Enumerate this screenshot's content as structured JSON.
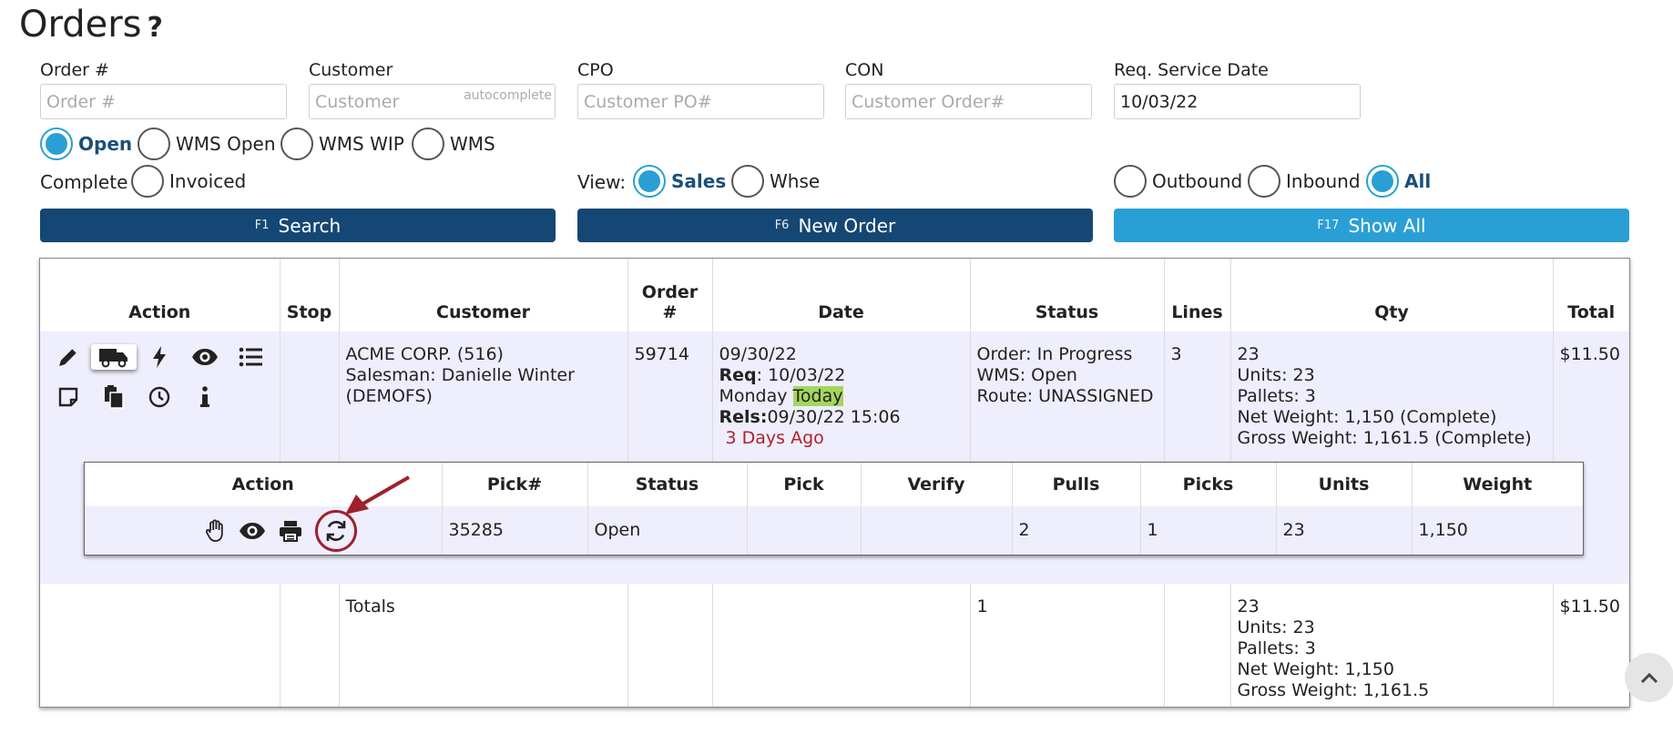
{
  "page": {
    "title": "Orders",
    "help_glyph": "?"
  },
  "filters": {
    "order": {
      "label": "Order #",
      "placeholder": "Order #",
      "value": ""
    },
    "customer": {
      "label": "Customer",
      "placeholder": "Customer",
      "value": "",
      "hint": "autocomplete"
    },
    "cpo": {
      "label": "CPO",
      "placeholder": "Customer PO#",
      "value": ""
    },
    "con": {
      "label": "CON",
      "placeholder": "Customer Order#",
      "value": ""
    },
    "req_date": {
      "label": "Req. Service Date",
      "placeholder": "",
      "value": "10/03/22"
    }
  },
  "status_radios": {
    "open": "Open",
    "wms_open": "WMS Open",
    "wms_wip": "WMS WIP",
    "wms": "WMS",
    "complete": "Complete",
    "invoiced": "Invoiced",
    "selected": "Open"
  },
  "view": {
    "label": "View:",
    "sales": "Sales",
    "whse": "Whse",
    "selected": "Sales"
  },
  "direction": {
    "outbound": "Outbound",
    "inbound": "Inbound",
    "all": "All",
    "selected": "All"
  },
  "buttons": {
    "search": {
      "key": "F1",
      "label": "Search"
    },
    "new_order": {
      "key": "F6",
      "label": "New Order"
    },
    "show_all": {
      "key": "F17",
      "label": "Show All"
    }
  },
  "colors": {
    "primary": "#154774",
    "accent": "#2a9fd6",
    "highlight": "#a4d65e",
    "row_bg": "#eeeefc",
    "alert_red": "#b0222a"
  },
  "orders_table": {
    "headers": {
      "action": "Action",
      "stop": "Stop",
      "customer": "Customer",
      "order_line1": "Order",
      "order_line2": "#",
      "date": "Date",
      "status": "Status",
      "lines": "Lines",
      "qty": "Qty",
      "total": "Total"
    },
    "action_icons": [
      "pencil-icon",
      "truck-icon",
      "bolt-icon",
      "eye-icon",
      "list-icon",
      "note-icon",
      "copy-icon",
      "clock-icon",
      "info-icon"
    ],
    "row": {
      "customer_name": "ACME CORP. (516)",
      "salesman": "Salesman: Danielle Winter (DEMOFS)",
      "order_no": "59714",
      "date": "09/30/22",
      "req_label": "Req",
      "req_value": ": 10/03/22",
      "day": "Monday ",
      "today": "Today",
      "rels_label": "Rels:",
      "rels_value": "09/30/22 15:06",
      "ago": "3 Days Ago",
      "status_order": "Order: In Progress",
      "status_wms": "WMS: Open",
      "status_route": "Route: UNASSIGNED",
      "lines": "3",
      "qty": "23",
      "units": "Units: 23",
      "pallets": "Pallets: 3",
      "net_weight": "Net Weight: 1,150 (Complete)",
      "gross_weight": "Gross Weight: 1,161.5 (Complete)",
      "total": "$11.50"
    },
    "totals": {
      "label": "Totals",
      "status_count": "1",
      "qty": "23",
      "units": "Units: 23",
      "pallets": "Pallets: 3",
      "net_weight": "Net Weight: 1,150",
      "gross_weight": "Gross Weight: 1,161.5",
      "total": "$11.50"
    }
  },
  "picks_table": {
    "headers": {
      "action": "Action",
      "pick_no": "Pick#",
      "status": "Status",
      "pick": "Pick",
      "verify": "Verify",
      "pulls": "Pulls",
      "picks": "Picks",
      "units": "Units",
      "weight": "Weight"
    },
    "action_icons": [
      "hand-icon",
      "eye-icon",
      "print-icon",
      "refresh-icon"
    ],
    "row": {
      "pick_no": "35285",
      "status": "Open",
      "pick": "",
      "verify": "",
      "pulls": "2",
      "picks": "1",
      "units": "23",
      "weight": "1,150"
    }
  }
}
